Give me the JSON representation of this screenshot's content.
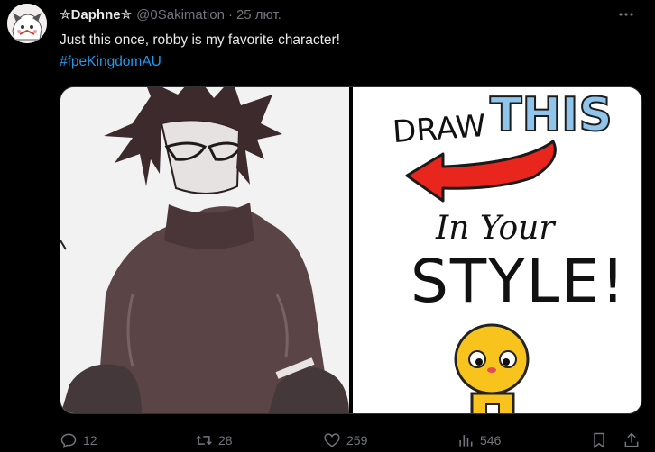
{
  "author": {
    "display_name": "✮Daphne✮",
    "handle": "@0Sakimation",
    "separator": "·",
    "timestamp": "25 лют."
  },
  "tweet": {
    "text": "Just this once, robby is my favorite character!",
    "hashtag": "#fpeKingdomAU"
  },
  "media": {
    "right_image": {
      "line1": "DRAW",
      "line1_highlight": "THIS",
      "line2": "In Your",
      "line3": "STYLE!"
    }
  },
  "actions": {
    "replies": "12",
    "retweets": "28",
    "likes": "259",
    "views": "546"
  },
  "colors": {
    "background": "#000000",
    "primary_text": "#e7e9ea",
    "secondary_text": "#71767b",
    "link": "#1d9bf0",
    "arrow_red": "#e8261d",
    "this_blue": "#8fc4ec"
  },
  "icons": [
    "more-icon",
    "reply-icon",
    "retweet-icon",
    "like-icon",
    "views-icon",
    "bookmark-icon",
    "share-icon"
  ]
}
